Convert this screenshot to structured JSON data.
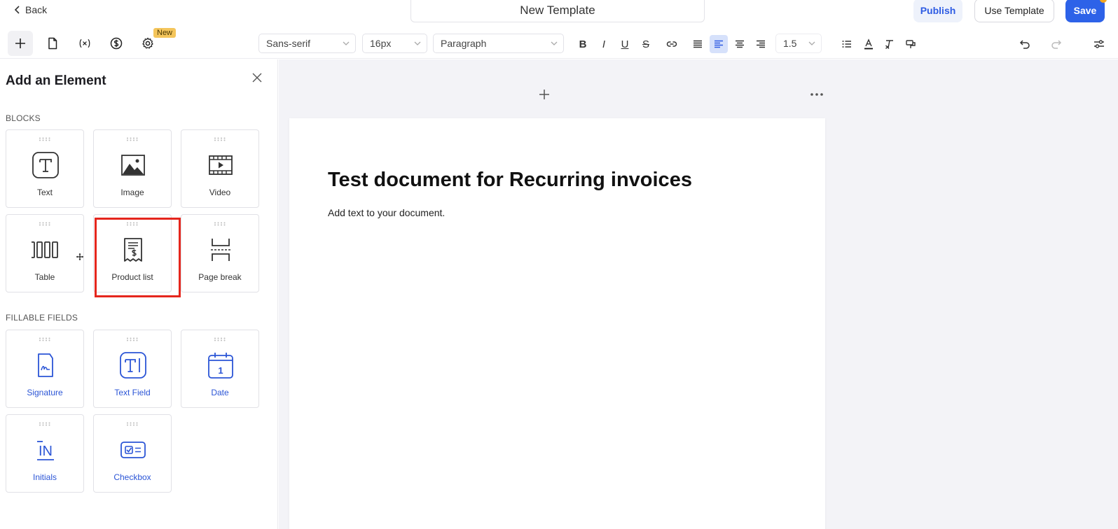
{
  "header": {
    "back_label": "Back",
    "document_title": "New Template",
    "publish_label": "Publish",
    "use_template_label": "Use Template",
    "save_label": "Save"
  },
  "toolbar": {
    "new_badge": "New",
    "font_family": "Sans-serif",
    "font_size": "16px",
    "block_style": "Paragraph",
    "line_height": "1.5",
    "bold": "B",
    "italic": "I",
    "underline": "U",
    "strike": "S",
    "align_active": "left"
  },
  "panel": {
    "title": "Add an Element",
    "blocks_label": "BLOCKS",
    "blocks": [
      {
        "label": "Text",
        "icon": "text-block-icon"
      },
      {
        "label": "Image",
        "icon": "image-icon"
      },
      {
        "label": "Video",
        "icon": "video-icon"
      },
      {
        "label": "Table",
        "icon": "table-icon"
      },
      {
        "label": "Product list",
        "icon": "product-list-icon"
      },
      {
        "label": "Page break",
        "icon": "page-break-icon"
      }
    ],
    "fields_label": "FILLABLE FIELDS",
    "fields": [
      {
        "label": "Signature",
        "icon": "signature-icon"
      },
      {
        "label": "Text Field",
        "icon": "text-field-icon"
      },
      {
        "label": "Date",
        "icon": "calendar-icon",
        "day": "1"
      },
      {
        "label": "Initials",
        "icon": "initials-icon",
        "glyph": "IN"
      },
      {
        "label": "Checkbox",
        "icon": "checkbox-icon"
      }
    ]
  },
  "document": {
    "heading": "Test document for Recurring invoices",
    "body": "Add text to your document."
  },
  "colors": {
    "accent": "#2d62e8",
    "highlight": "#e5261d",
    "badge": "#f4c55b",
    "field_blue": "#2b55d6"
  }
}
